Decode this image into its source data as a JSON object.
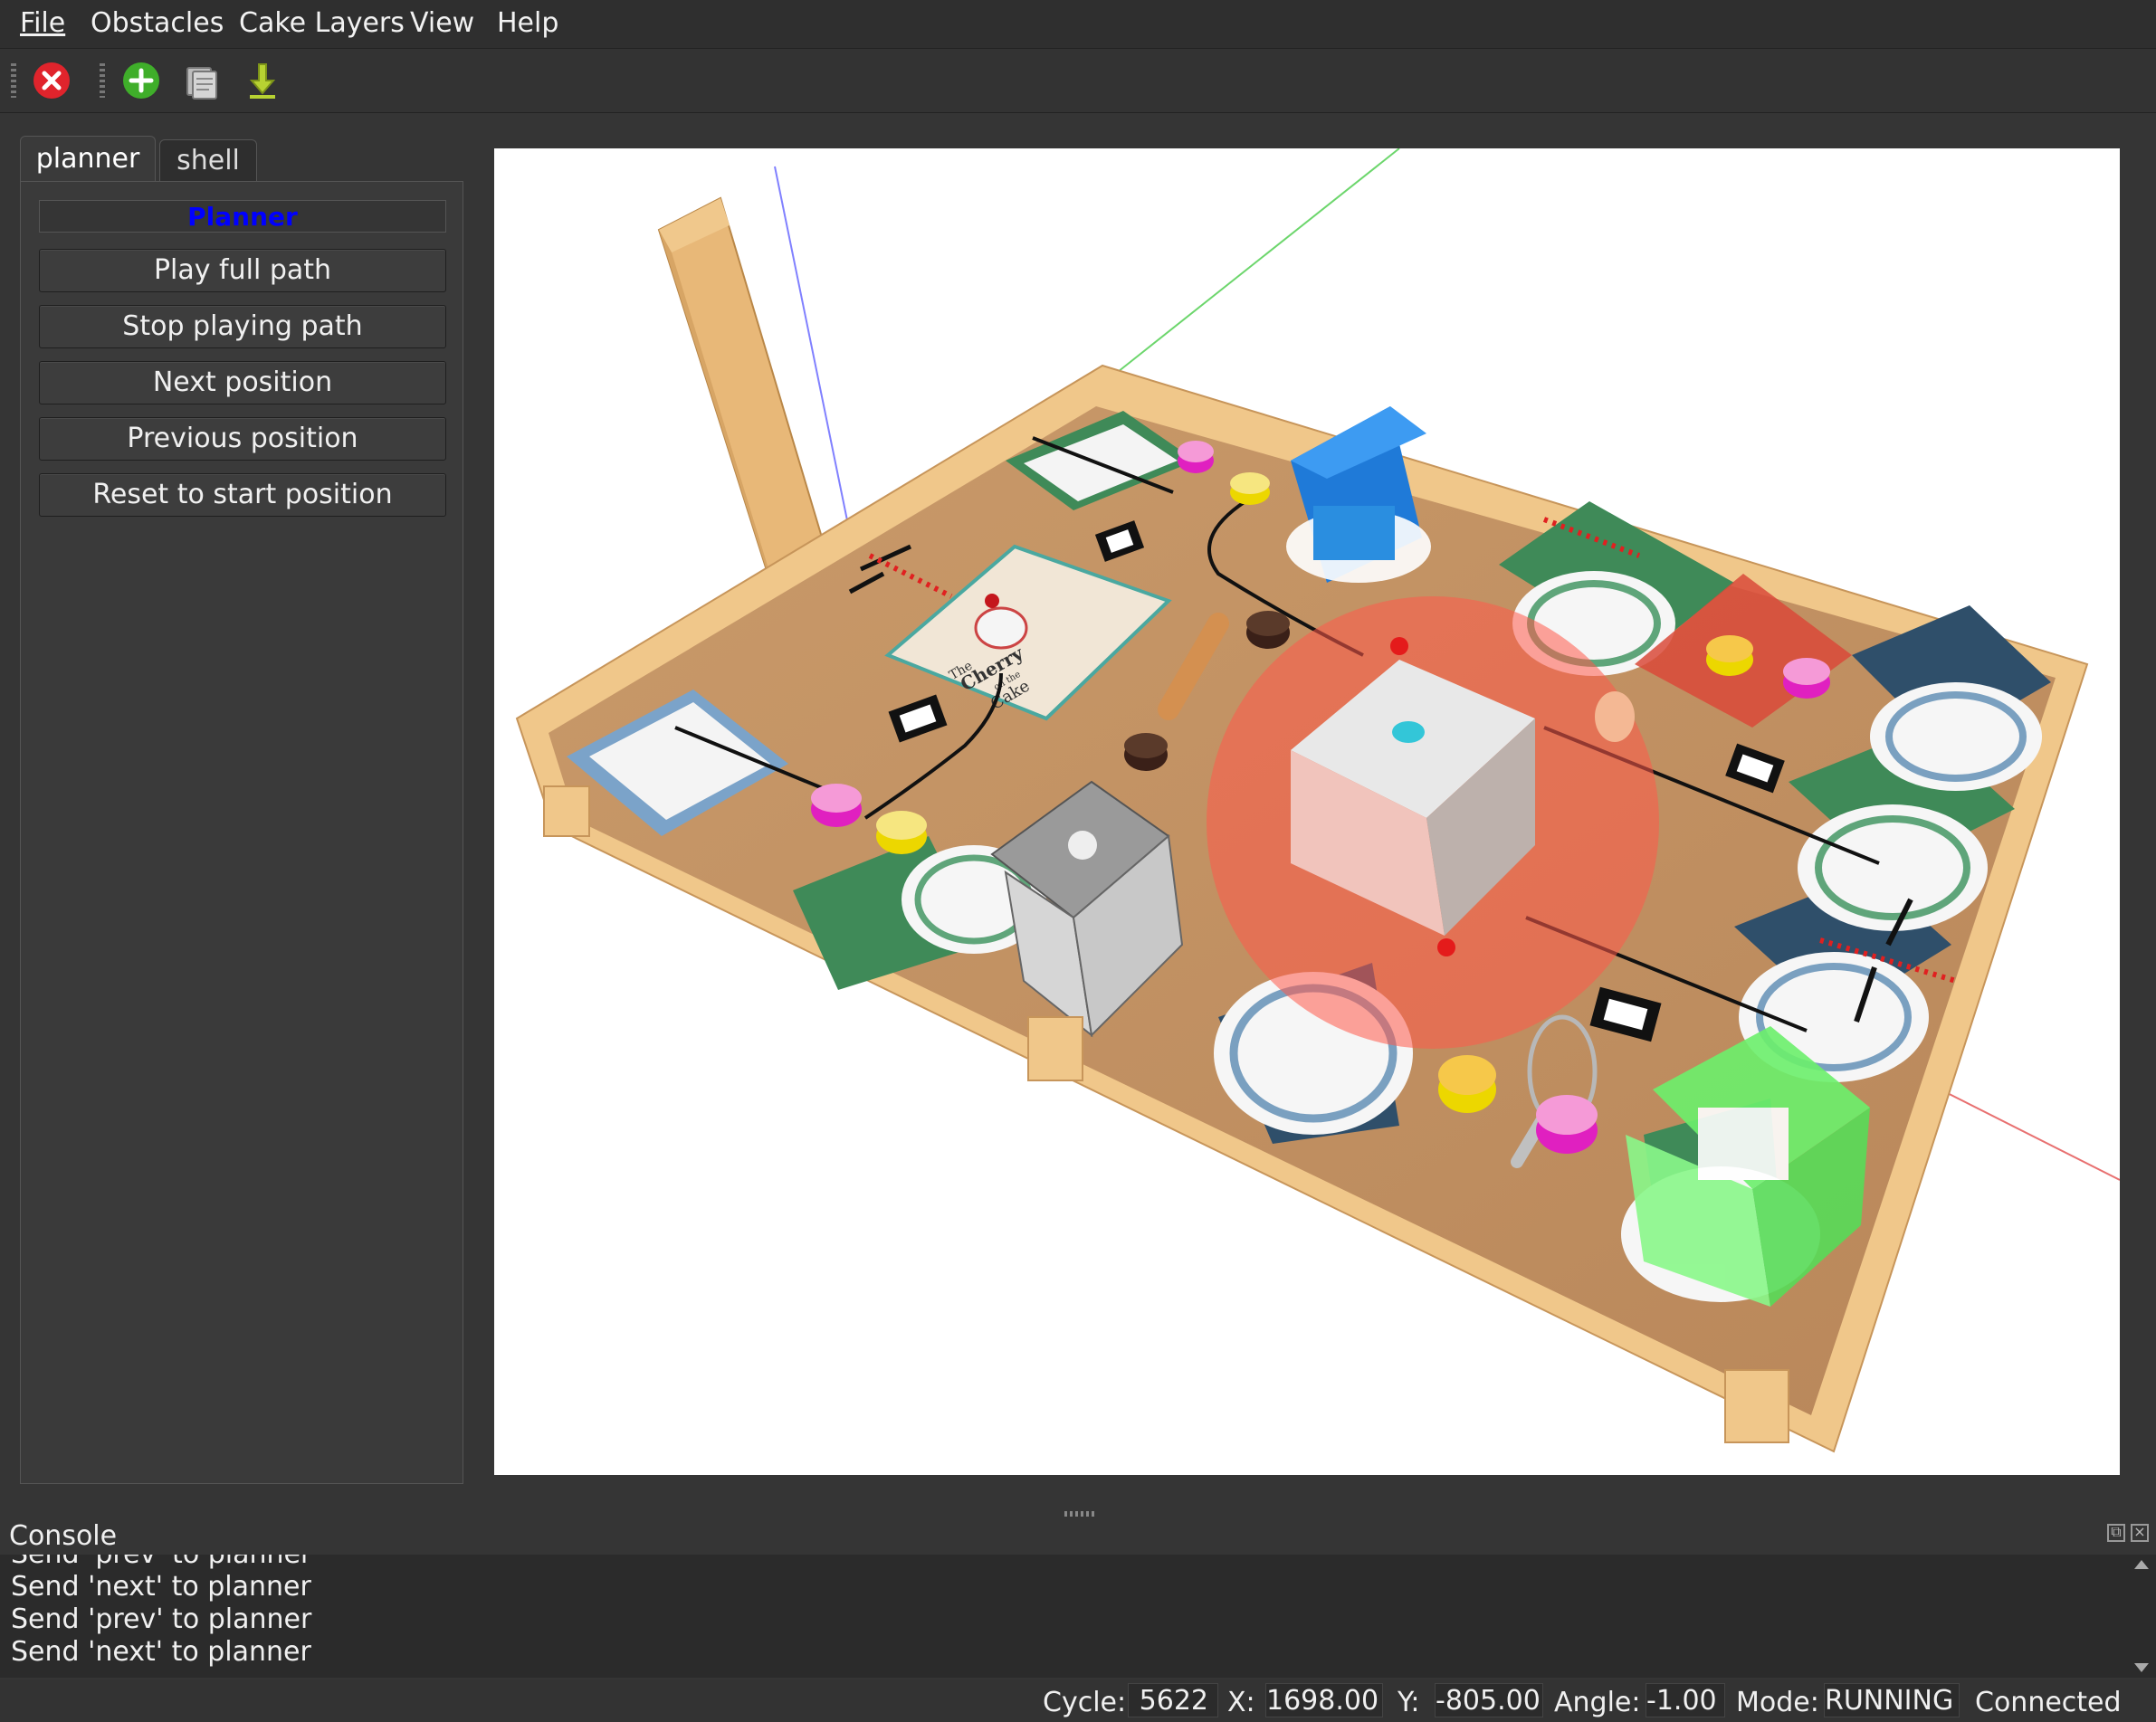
{
  "menu": {
    "items": [
      "File",
      "Obstacles",
      "Cake Layers",
      "View",
      "Help"
    ]
  },
  "toolbar": {
    "buttons": [
      {
        "name": "stop",
        "icon": "close-icon",
        "color": "#e0242c"
      },
      {
        "name": "add",
        "icon": "plus-icon",
        "color": "#3fae2a"
      },
      {
        "name": "open",
        "icon": "folder-icon",
        "color": "#9a9a9a"
      },
      {
        "name": "download",
        "icon": "download-arrow-icon",
        "color": "#b7d232"
      }
    ]
  },
  "tabs": [
    {
      "label": "planner",
      "active": true
    },
    {
      "label": "shell",
      "active": false
    }
  ],
  "planner": {
    "title": "Planner",
    "title_color": "#0000ff",
    "buttons": [
      "Play full path",
      "Stop playing path",
      "Next position",
      "Previous position",
      "Reset to start position"
    ]
  },
  "scene": {
    "book_text": [
      "The",
      "Cherry",
      "on the",
      "Cake"
    ]
  },
  "console": {
    "title": "Console",
    "lines": [
      "Send 'prev' to planner",
      "Send 'next' to planner",
      "Send 'prev' to planner",
      "Send 'next' to planner"
    ]
  },
  "status": {
    "cycle_label": "Cycle:",
    "cycle": "5622",
    "x_label": "X:",
    "x": "1698.00",
    "y_label": "Y:",
    "y": "-805.00",
    "angle_label": "Angle:",
    "angle": "-1.00",
    "mode_label": "Mode:",
    "mode": "RUNNING",
    "connection": "Connected"
  }
}
